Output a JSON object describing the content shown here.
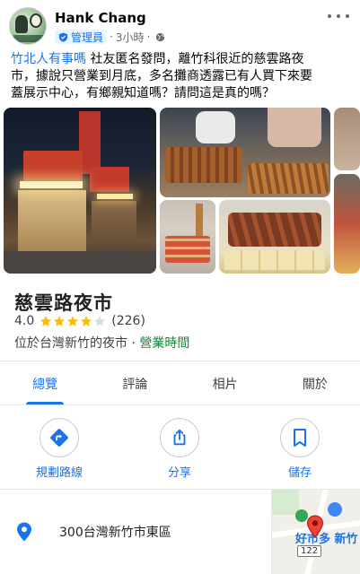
{
  "post": {
    "author": "Hank Chang",
    "role": "管理員",
    "time": "3小時",
    "group_link": "竹北人有事嗎",
    "lines": [
      " 社友匿名發問，離竹科很近的慈雲路夜",
      "市，據說只營業到月底，多名攤商透露已有人買下來要",
      "蓋展示中心，有鄉親知道嗎？請問這是真的嗎？"
    ]
  },
  "place": {
    "name": "慈雲路夜市",
    "rating": "4.0",
    "rating_value": 4.0,
    "review_count": "(226)",
    "category": "位於台灣新竹的夜市",
    "separator": " · ",
    "hours_link": "營業時間"
  },
  "tabs": [
    {
      "label": "總覽",
      "active": true
    },
    {
      "label": "評論",
      "active": false
    },
    {
      "label": "相片",
      "active": false
    },
    {
      "label": "關於",
      "active": false
    }
  ],
  "actions": {
    "directions": "規劃路線",
    "share": "分享",
    "save": "儲存"
  },
  "address": "300台灣新竹市東區",
  "map": {
    "label": "好市多 新竹",
    "route_number": "122"
  },
  "colors": {
    "link_blue": "#1a73e8",
    "star_gold": "#fbbc04",
    "hours_green": "#188038",
    "pin_blue": "#1a73e8",
    "pin_red": "#ea4335"
  }
}
